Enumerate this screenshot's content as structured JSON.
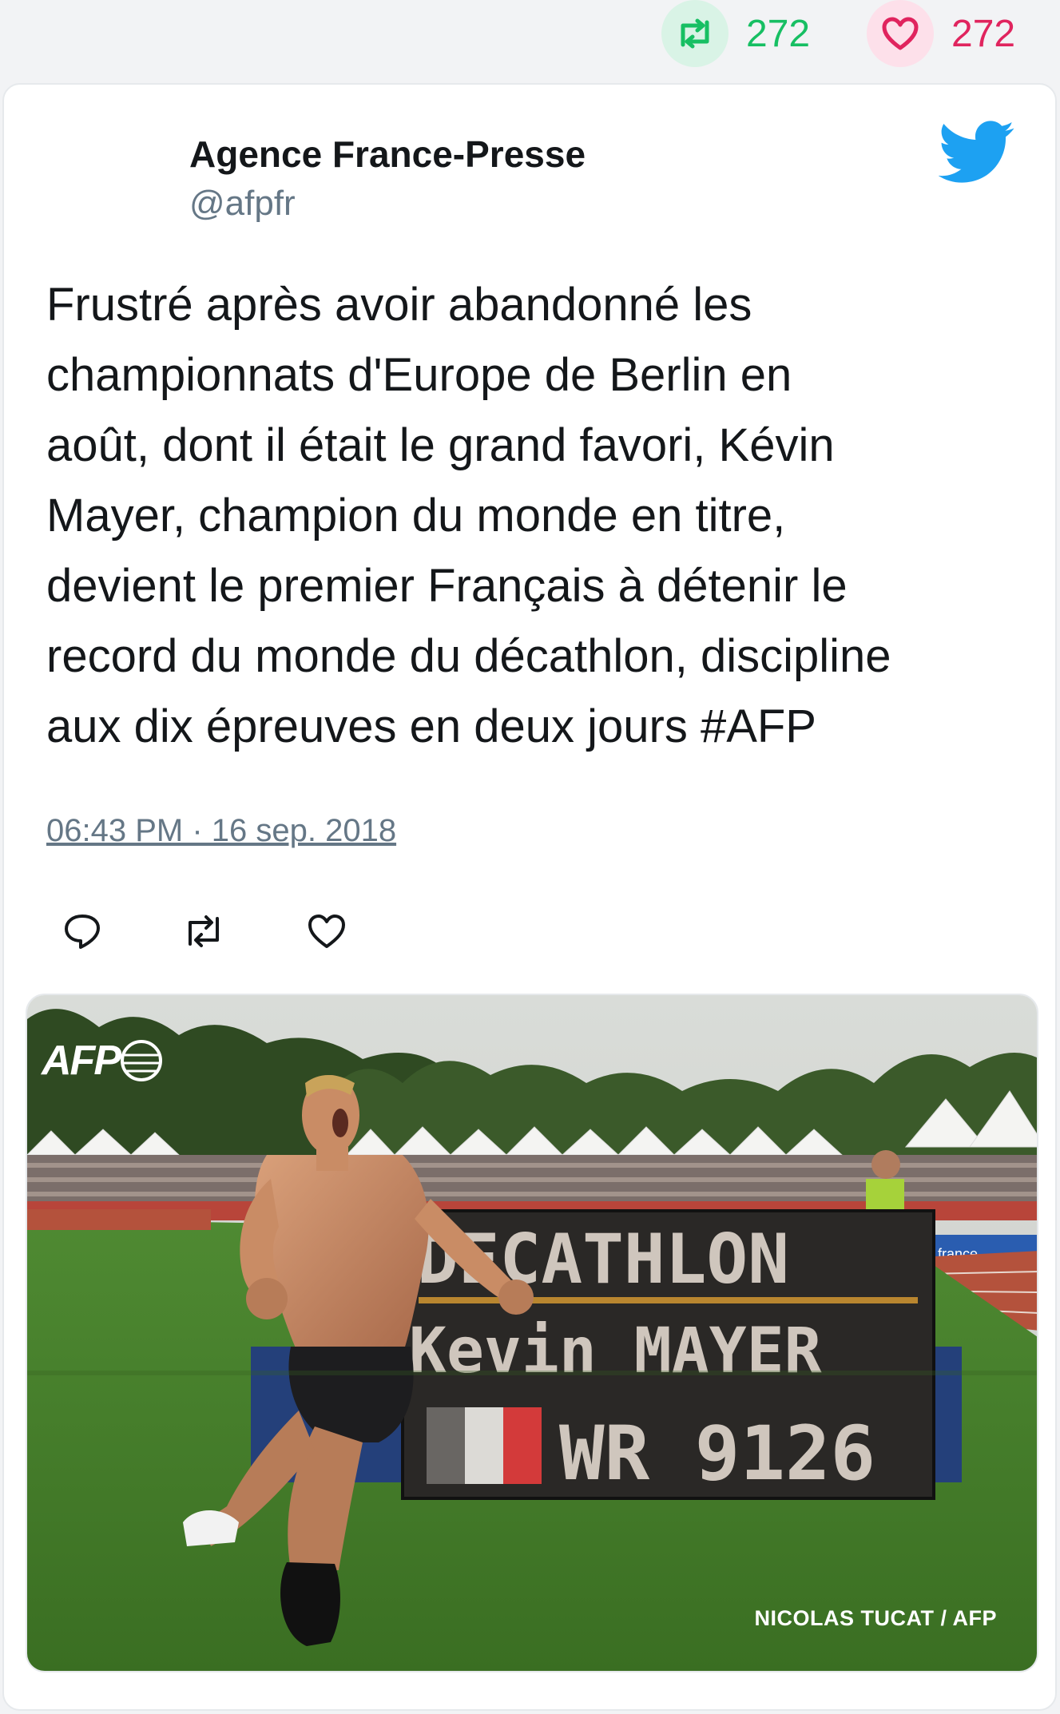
{
  "stats": {
    "retweets": "272",
    "likes": "272",
    "retweet_icon": "retweet-icon",
    "like_icon": "heart-icon",
    "retweet_color": "#17bf63",
    "like_color": "#e0245e"
  },
  "tweet": {
    "author_name": "Agence France-Presse",
    "author_handle": "@afpfr",
    "logo_icon": "twitter-bird-icon",
    "text": "Frustré après avoir abandonné les\nchampionnats d'Europe de Berlin en\naoût, dont il était le grand favori, Kévin\nMayer, champion du monde en titre,\ndevient le premier Français à détenir le\nrecord du monde du décathlon, discipline\naux dix épreuves en deux jours #AFP",
    "timestamp": "06:43 PM · 16 sep. 2018",
    "actions": {
      "reply_icon": "reply-icon",
      "retweet_icon": "retweet-icon",
      "like_icon": "heart-icon"
    }
  },
  "photo": {
    "logo_text": "AFP",
    "board_line1": "DECATHLON",
    "board_line2": "Kevin MAYER",
    "board_line3": "WR 9126",
    "credit": "NICOLAS TUCAT / AFP",
    "banner_text": "france"
  },
  "colors": {
    "twitter_blue": "#1da1f2",
    "text": "#14171a",
    "muted": "#657786"
  }
}
